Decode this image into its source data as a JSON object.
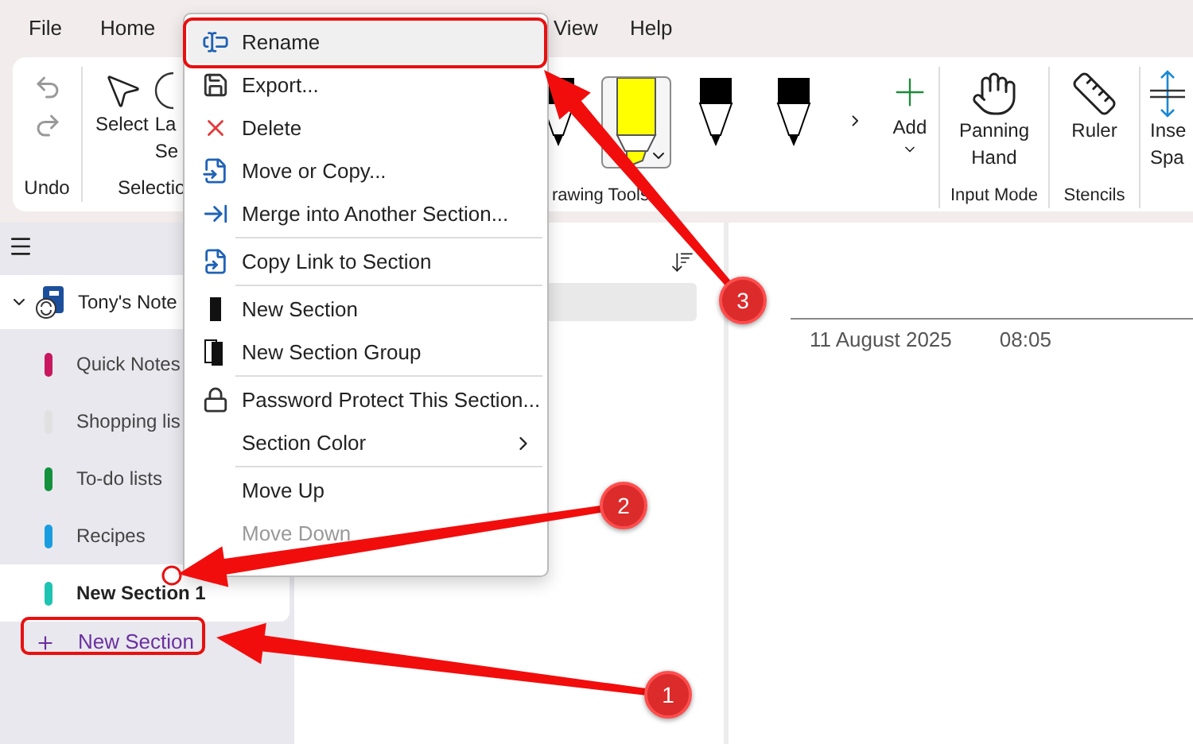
{
  "menu_bar": {
    "left": [
      "File",
      "Home"
    ],
    "right": [
      "View",
      "Help"
    ]
  },
  "ribbon": {
    "undo_group": {
      "label": "Undo"
    },
    "selection_group": {
      "label": "Selectio",
      "buttons": [
        {
          "lines": [
            "Select"
          ]
        },
        {
          "lines": [
            "La",
            "Se"
          ]
        }
      ]
    },
    "drawing_group": {
      "label": "rawing Tools",
      "pens": [
        {
          "kind": "pen",
          "selected": false
        },
        {
          "kind": "highlighter",
          "selected": true
        },
        {
          "kind": "pen",
          "selected": false
        },
        {
          "kind": "pen",
          "selected": false
        }
      ],
      "add": {
        "label": "Add"
      }
    },
    "groups": [
      {
        "label": "Input Mode",
        "button": {
          "lines": [
            "Panning",
            "Hand"
          ]
        }
      },
      {
        "label": "Stencils",
        "button": {
          "lines": [
            "Ruler"
          ]
        }
      },
      {
        "button": {
          "lines": [
            "Inse",
            "Spa"
          ]
        }
      }
    ]
  },
  "sidebar": {
    "notebook": {
      "title": "Tony's Note",
      "expanded": true
    },
    "sections": [
      {
        "name": "Quick Notes",
        "color": "#c8175f",
        "selected": false
      },
      {
        "name": "Shopping lis",
        "color": "#e1e1e1",
        "selected": false
      },
      {
        "name": "To-do lists",
        "color": "#13913d",
        "selected": false
      },
      {
        "name": "Recipes",
        "color": "#1a9de0",
        "selected": false
      },
      {
        "name": "New Section 1",
        "color": "#1fc3b1",
        "selected": true
      }
    ],
    "add_section": {
      "label": "New Section"
    }
  },
  "page_list": {
    "pages": [
      {
        "selected": true
      }
    ]
  },
  "page": {
    "date": "11 August 2025",
    "time": "08:05"
  },
  "context_menu": {
    "items": [
      {
        "kind": "item",
        "label": "Rename",
        "selected": true,
        "disabled": false,
        "submenu": false
      },
      {
        "kind": "item",
        "label": "Export...",
        "selected": false,
        "disabled": false,
        "submenu": false
      },
      {
        "kind": "item",
        "label": "Delete",
        "selected": false,
        "disabled": false,
        "submenu": false
      },
      {
        "kind": "item",
        "label": "Move or Copy...",
        "selected": false,
        "disabled": false,
        "submenu": false
      },
      {
        "kind": "item",
        "label": "Merge into Another Section...",
        "selected": false,
        "disabled": false,
        "submenu": false
      },
      {
        "kind": "separator"
      },
      {
        "kind": "item",
        "label": "Copy Link to Section",
        "selected": false,
        "disabled": false,
        "submenu": false
      },
      {
        "kind": "separator"
      },
      {
        "kind": "item",
        "label": "New Section",
        "selected": false,
        "disabled": false,
        "submenu": false
      },
      {
        "kind": "item",
        "label": "New Section Group",
        "selected": false,
        "disabled": false,
        "submenu": false
      },
      {
        "kind": "separator"
      },
      {
        "kind": "item",
        "label": "Password Protect This Section...",
        "selected": false,
        "disabled": false,
        "submenu": false
      },
      {
        "kind": "item",
        "label": "Section Color",
        "selected": false,
        "disabled": false,
        "submenu": true
      },
      {
        "kind": "separator"
      },
      {
        "kind": "item",
        "label": "Move Up",
        "selected": false,
        "disabled": false,
        "submenu": false
      },
      {
        "kind": "item",
        "label": "Move Down",
        "selected": false,
        "disabled": true,
        "submenu": false
      }
    ]
  },
  "callouts": [
    {
      "number": "1"
    },
    {
      "number": "2"
    },
    {
      "number": "3"
    }
  ]
}
